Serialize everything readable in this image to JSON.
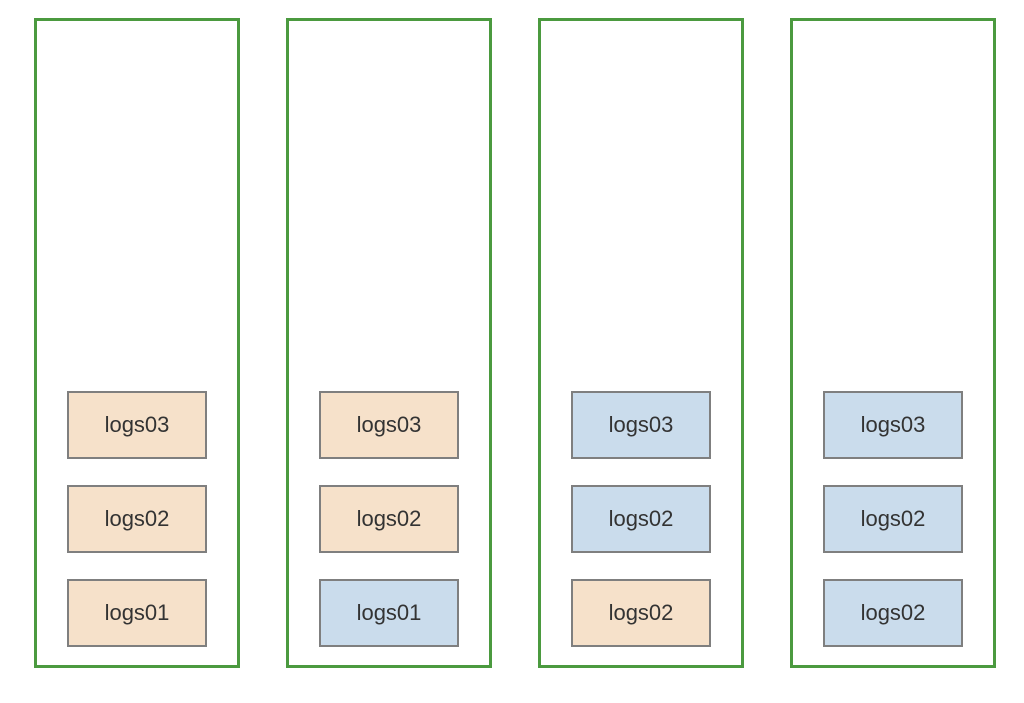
{
  "colors": {
    "column_border": "#4b9a3f",
    "shard_border": "#7f7f7f",
    "fill_orange": "#f6e1ca",
    "fill_blue": "#cadcec"
  },
  "columns": [
    {
      "id": "col-1",
      "shards": [
        {
          "label": "logs03",
          "color": "orange"
        },
        {
          "label": "logs02",
          "color": "orange"
        },
        {
          "label": "logs01",
          "color": "orange"
        }
      ]
    },
    {
      "id": "col-2",
      "shards": [
        {
          "label": "logs03",
          "color": "orange"
        },
        {
          "label": "logs02",
          "color": "orange"
        },
        {
          "label": "logs01",
          "color": "blue"
        }
      ]
    },
    {
      "id": "col-3",
      "shards": [
        {
          "label": "logs03",
          "color": "blue"
        },
        {
          "label": "logs02",
          "color": "blue"
        },
        {
          "label": "logs02",
          "color": "orange"
        }
      ]
    },
    {
      "id": "col-4",
      "shards": [
        {
          "label": "logs03",
          "color": "blue"
        },
        {
          "label": "logs02",
          "color": "blue"
        },
        {
          "label": "logs02",
          "color": "blue"
        }
      ]
    }
  ]
}
